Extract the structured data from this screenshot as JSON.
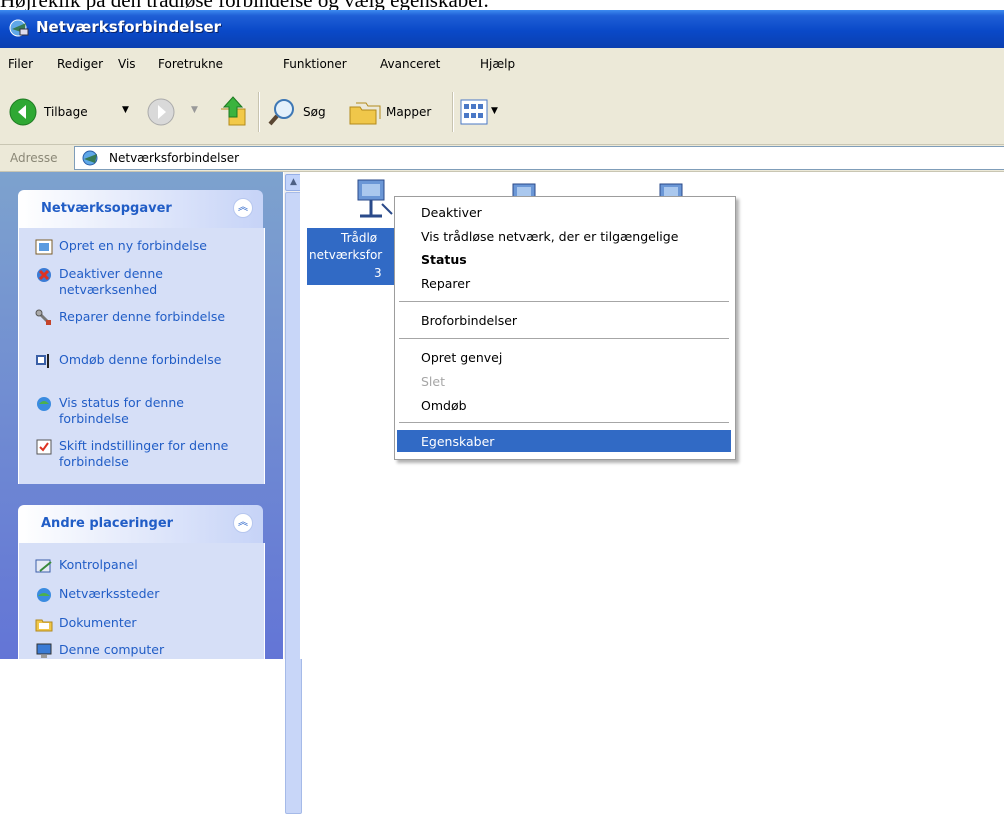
{
  "caption": "Højreklik på den trådløse forbindelse og vælg egenskaber.",
  "window": {
    "title": "Netværksforbindelser"
  },
  "menu": [
    "Filer",
    "Rediger",
    "Vis",
    "Foretrukne",
    "Funktioner",
    "Avanceret",
    "Hjælp"
  ],
  "toolbar": {
    "back_label": "Tilbage",
    "search_label": "Søg",
    "folders_label": "Mapper"
  },
  "address": {
    "label": "Adresse",
    "value": "Netværksforbindelser"
  },
  "tasks_panel": {
    "title": "Netværksopgaver",
    "items": [
      {
        "label": "Opret en ny forbindelse",
        "icon": "new-connection-icon"
      },
      {
        "label": "Deaktiver denne netværksenhed",
        "icon": "disable-network-icon"
      },
      {
        "label": "Reparer denne forbindelse",
        "icon": "repair-icon"
      },
      {
        "label": "Omdøb denne forbindelse",
        "icon": "rename-icon"
      },
      {
        "label": "Vis status for denne forbindelse",
        "icon": "status-icon"
      },
      {
        "label": "Skift indstillinger for denne forbindelse",
        "icon": "settings-icon"
      }
    ]
  },
  "places_panel": {
    "title": "Andre placeringer",
    "items": [
      {
        "label": "Kontrolpanel",
        "icon": "control-panel-icon"
      },
      {
        "label": "Netværkssteder",
        "icon": "network-places-icon"
      },
      {
        "label": "Dokumenter",
        "icon": "documents-icon"
      },
      {
        "label": "Denne computer",
        "icon": "computer-icon"
      }
    ]
  },
  "selected_connection": {
    "line1": "Trådlø",
    "line2": "netværksfor",
    "line3": "3"
  },
  "context_menu": {
    "items": [
      "Deaktiver",
      "Vis trådløse netværk, der er tilgængelige",
      "Status",
      "Reparer",
      "Broforbindelser",
      "Opret genvej",
      "Slet",
      "Omdøb",
      "Egenskaber"
    ]
  },
  "colors": {
    "titlebar": "#0a49c8",
    "selection": "#316ac5",
    "task_link": "#215dc6",
    "taskpane_bg": "#6375d6"
  }
}
